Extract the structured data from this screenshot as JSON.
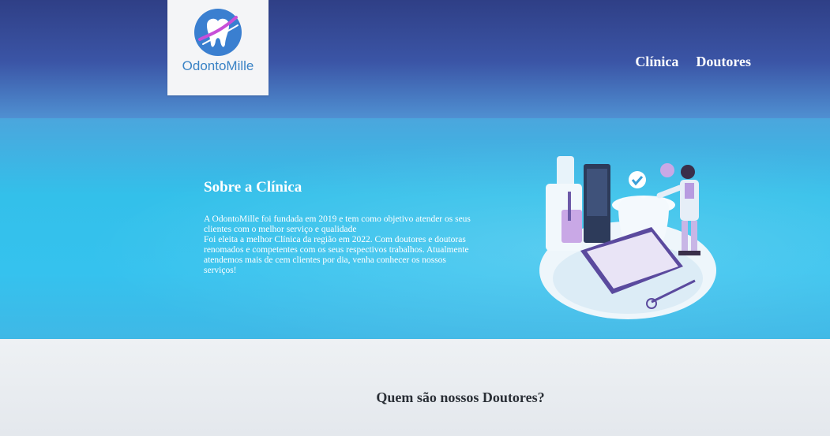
{
  "logo": {
    "name": "OdontoMille",
    "icon": "tooth-logo-icon"
  },
  "nav": {
    "items": [
      {
        "label": "Clínica"
      },
      {
        "label": "Doutores"
      }
    ]
  },
  "about": {
    "title": "Sobre a Clínica",
    "lines": [
      "A OdontoMille foi fundada em 2019 e tem como objetivo atender os seus",
      "clientes com o melhor serviço e qualidade",
      "Foi eleita a melhor Clínica da região em 2022. Com doutores e doutoras",
      "renomados e competentes com os seus respectivos trabalhos. Atualmente",
      "atendemos mais de cem clientes por dia, venha conhecer os nossos",
      "serviços!"
    ]
  },
  "illustration": {
    "icon": "dentist-illustration-icon"
  },
  "doctors": {
    "heading": "Quem são nossos Doutores?"
  },
  "colors": {
    "header": "#34479a",
    "hero": "#35c2ee",
    "logo_text": "#3a83c5"
  }
}
